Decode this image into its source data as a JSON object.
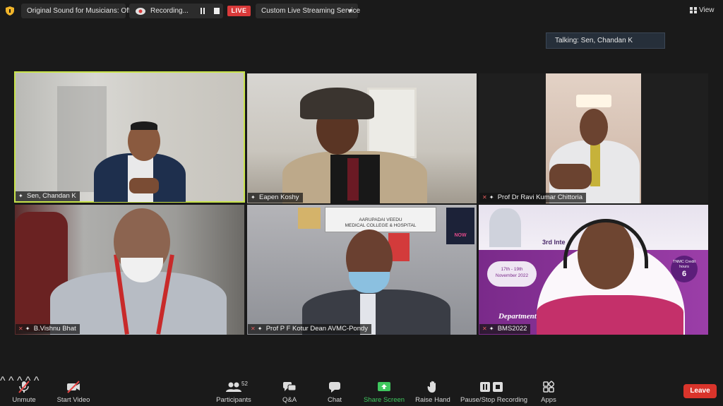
{
  "topbar": {
    "sound_label": "Original Sound for Musicians: Off",
    "recording_label": "Recording...",
    "live_label": "LIVE",
    "stream_label": "Custom Live Streaming Service",
    "view_label": "View"
  },
  "talking": "Talking: Sen, Chandan K",
  "participants": [
    {
      "name": "Sen, Chandan K",
      "active": true
    },
    {
      "name": "Eapen Koshy"
    },
    {
      "name": "Prof Dr Ravi Kumar Chittoria"
    },
    {
      "name": "B.Vishnu Bhat"
    },
    {
      "name": "Prof P F Kotur Dean AVMC-Pondy"
    },
    {
      "name": "BMS2022"
    }
  ],
  "tile5_banner": {
    "line1": "AARUPADAI VEEDU",
    "line2": "MEDICAL COLLEGE & HOSPITAL",
    "poster": "NOW"
  },
  "tile6_slide": {
    "heading": "3rd Inte         erence",
    "dates": "17th - 19th November 2022",
    "credit_label": "TNMC Credit hours",
    "credit_value": "6",
    "dept": "Department"
  },
  "toolbar": {
    "unmute": "Unmute",
    "start_video": "Start Video",
    "participants": "Participants",
    "participants_count": "52",
    "qa": "Q&A",
    "chat": "Chat",
    "share": "Share Screen",
    "raise": "Raise Hand",
    "record": "Pause/Stop Recording",
    "apps": "Apps",
    "leave": "Leave"
  },
  "colors": {
    "live": "#d93a3a",
    "active_speaker": "#c8e34a",
    "share": "#3fc75e",
    "leave": "#d9342b"
  }
}
